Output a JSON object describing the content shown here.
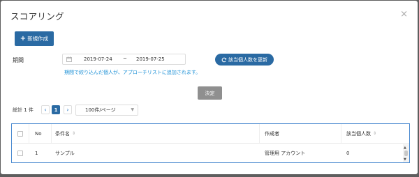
{
  "dialog": {
    "title": "スコアリング",
    "close_glyph": "×"
  },
  "toolbar": {
    "new_label": "新規作成",
    "plus_glyph": "+"
  },
  "filter": {
    "period_label": "期間",
    "date_from": "2019-07-24",
    "date_sep": "~",
    "date_to": "2019-07-25",
    "update_label": "該当個人数を更新",
    "hint": "期間で絞り込んだ個人が、アプローチリストに追加されます。",
    "decide_label": "決定"
  },
  "pagination": {
    "total": "総計 1 件",
    "prev": "‹",
    "current_page": "1",
    "next": "›",
    "per_page": "100件/ページ"
  },
  "table": {
    "columns": [
      "No",
      "条件名",
      "作成者",
      "該当個人数"
    ],
    "sort_glyph": "⇕",
    "rows": [
      {
        "no": "1",
        "name": "サンプル",
        "author": "管理用 アカウント",
        "count": "0"
      }
    ]
  },
  "colors": {
    "primary": "#2a6aa3",
    "hint": "#1a8fd6",
    "disabled": "#8f8f8f"
  }
}
